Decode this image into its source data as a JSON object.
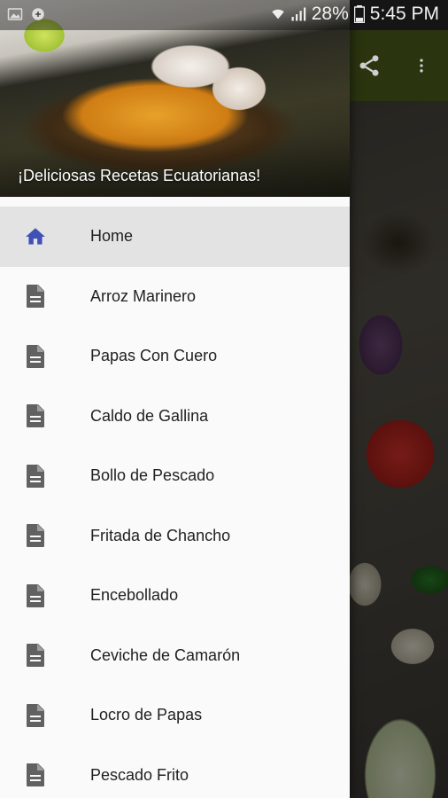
{
  "status_bar": {
    "battery": "28%",
    "time": "5:45 PM"
  },
  "drawer": {
    "header_title": "¡Deliciosas Recetas Ecuatorianas!",
    "items": [
      {
        "label": "Home",
        "icon": "home-icon",
        "active": true
      },
      {
        "label": "Arroz Marinero",
        "icon": "document-icon"
      },
      {
        "label": "Papas Con Cuero",
        "icon": "document-icon"
      },
      {
        "label": "Caldo de Gallina",
        "icon": "document-icon"
      },
      {
        "label": "Bollo de Pescado",
        "icon": "document-icon"
      },
      {
        "label": "Fritada de Chancho",
        "icon": "document-icon"
      },
      {
        "label": "Encebollado",
        "icon": "document-icon"
      },
      {
        "label": "Ceviche de Camarón",
        "icon": "document-icon"
      },
      {
        "label": "Locro de Papas",
        "icon": "document-icon"
      },
      {
        "label": "Pescado Frito",
        "icon": "document-icon"
      }
    ]
  },
  "background_app": {
    "toolbar_icons": [
      "share-icon",
      "more-vert-icon"
    ]
  },
  "colors": {
    "active_icon": "#3f51b5",
    "doc_icon": "#616161",
    "toolbar": "#4e5f1c"
  }
}
